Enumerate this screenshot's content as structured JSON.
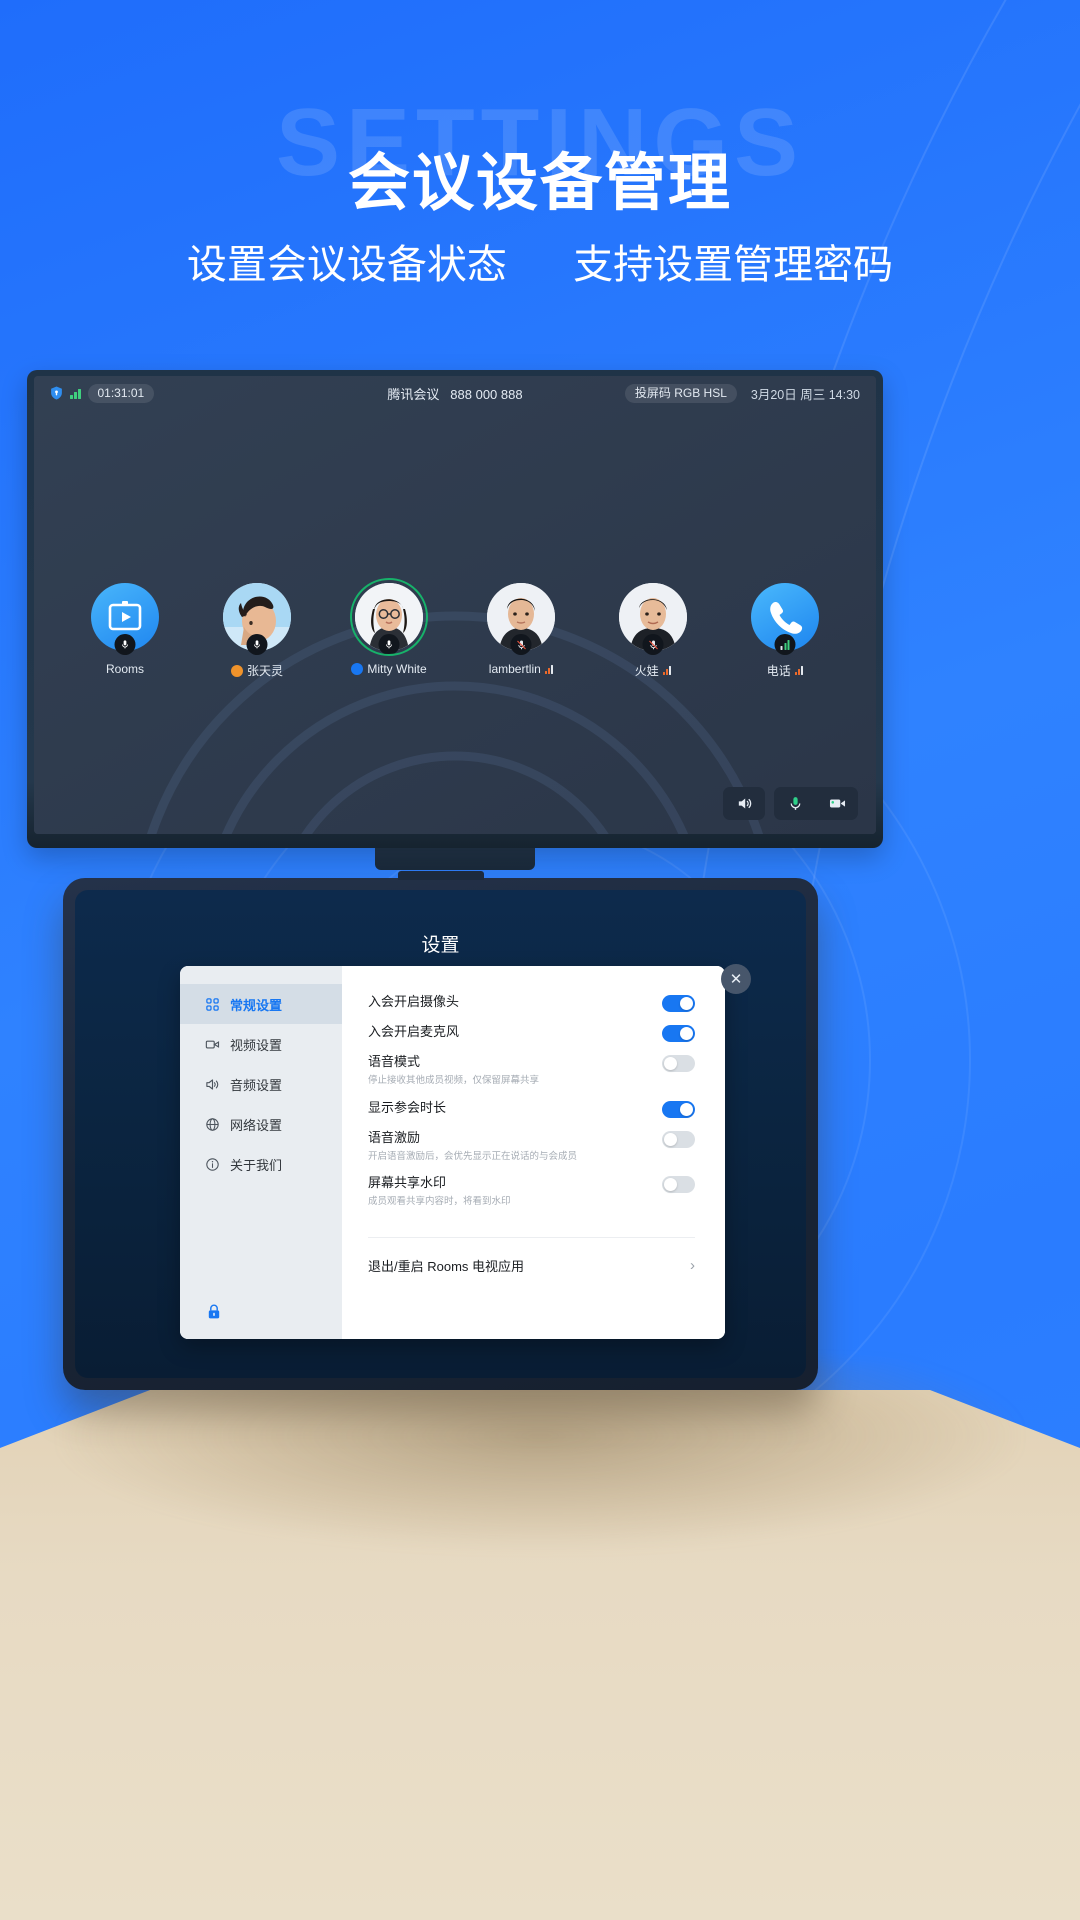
{
  "hero": {
    "ghost_text": "SETTINGS",
    "title": "会议设备管理",
    "subtitle_left": "设置会议设备状态",
    "subtitle_right": "支持设置管理密码"
  },
  "tv": {
    "statusbar": {
      "shield_icon": "shield-icon",
      "signal_icon": "signal-bars-icon",
      "timer": "01:31:01",
      "meeting_title": "腾讯会议",
      "meeting_id": "888 000 888",
      "cast_code": "投屏码 RGB HSL",
      "datetime": "3月20日 周三 14:30"
    },
    "participants": [
      {
        "name": "Rooms",
        "type": "rooms",
        "mic": "mic-on-icon",
        "host_badge": null,
        "signal": null,
        "speaking": false
      },
      {
        "name": "张天灵",
        "type": "photo-male-1",
        "mic": "mic-on-icon",
        "host_badge": "#f0932b",
        "signal": null,
        "speaking": false
      },
      {
        "name": "Mitty White",
        "type": "photo-female-1",
        "mic": "mic-on-icon",
        "host_badge": "#1877f2",
        "signal": null,
        "speaking": true
      },
      {
        "name": "lambertlin",
        "type": "photo-male-2",
        "mic": "mic-off-icon",
        "host_badge": null,
        "signal": "#ef6b2b",
        "speaking": false
      },
      {
        "name": "火娃",
        "type": "photo-male-3",
        "mic": "mic-off-icon",
        "host_badge": null,
        "signal": "#ef6b2b",
        "speaking": false
      },
      {
        "name": "电话",
        "type": "phone",
        "mic": "signal-badge-icon",
        "host_badge": null,
        "signal": "#ef6b2b",
        "speaking": false
      }
    ],
    "controls": [
      {
        "name": "speaker-button",
        "icon": "speaker-icon"
      },
      {
        "name": "microphone-button",
        "icon": "microphone-icon"
      },
      {
        "name": "camera-button",
        "icon": "camera-icon"
      }
    ]
  },
  "tablet": {
    "screen_title": "设置",
    "dialog": {
      "close_label": "✕",
      "sidebar": [
        {
          "label": "常规设置",
          "icon": "grid-icon",
          "active": true
        },
        {
          "label": "视频设置",
          "icon": "video-icon",
          "active": false
        },
        {
          "label": "音频设置",
          "icon": "audio-icon",
          "active": false
        },
        {
          "label": "网络设置",
          "icon": "globe-icon",
          "active": false
        },
        {
          "label": "关于我们",
          "icon": "info-icon",
          "active": false
        }
      ],
      "lock_icon": "lock-icon",
      "rows": [
        {
          "label": "入会开启摄像头",
          "desc": "",
          "on": true
        },
        {
          "label": "入会开启麦克风",
          "desc": "",
          "on": true
        },
        {
          "label": "语音模式",
          "desc": "停止接收其他成员视频，仅保留屏幕共享",
          "on": false
        },
        {
          "label": "显示参会时长",
          "desc": "",
          "on": true
        },
        {
          "label": "语音激励",
          "desc": "开启语音激励后，会优先显示正在说话的与会成员",
          "on": false
        },
        {
          "label": "屏幕共享水印",
          "desc": "成员观看共享内容时，将看到水印",
          "on": false
        }
      ],
      "action": {
        "label": "退出/重启 Rooms 电视应用",
        "chevron": "›"
      }
    }
  },
  "colors": {
    "brand_blue": "#1877f2",
    "page_blue": "#2a7cff",
    "speaking_green": "#17b26a",
    "signal_orange": "#ef6b2b"
  }
}
